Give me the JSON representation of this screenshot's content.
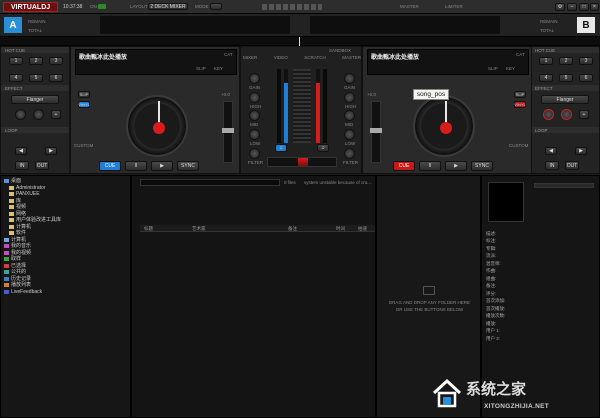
{
  "topbar": {
    "logo": "VIRTUALDJ",
    "clock": "10:37:38",
    "on_label": "ON",
    "layout_label": "LAYOUT",
    "layout_value": "2 DECK MIXER",
    "mode_label": "MODE",
    "master_label": "MASTER",
    "limiter_label": "LIMITER"
  },
  "deckA": {
    "label": "A",
    "subtitle": "REMAIN",
    "total": "TOTAL",
    "song_title": "歌曲甄冰此处播放",
    "cue": "CUE",
    "pause": "II",
    "play": "▶",
    "sync": "SYNC",
    "bpm": "+0.0",
    "hotcue": "HOT CUE",
    "effect": "EFFECT",
    "effect_value": "Flanger",
    "loop": "LOOP",
    "in": "IN",
    "out": "OUT",
    "custom": "CUSTOM",
    "cat": "CAT",
    "slip": "SLIP",
    "key": "KEY",
    "vinyl": "VINYL"
  },
  "deckB": {
    "label": "B",
    "subtitle": "REMAIN",
    "total": "TOTAL",
    "song_title": "歌曲甄冰此处播放",
    "cue": "CUE",
    "pause": "II",
    "play": "▶",
    "sync": "SYNC",
    "bpm": "+0.0",
    "hotcue": "HOT CUE",
    "effect": "EFFECT",
    "effect_value": "Flanger",
    "loop": "LOOP",
    "in": "IN",
    "out": "OUT",
    "custom": "CUSTOM",
    "cat": "CAT",
    "slip": "SLIP",
    "key": "KEY",
    "vinyl": "VINYL"
  },
  "mixer": {
    "tabs": [
      "MIXER",
      "VIDEO",
      "SCRATCH",
      "MASTER"
    ],
    "sandbox": "SANDBOX",
    "gain": "GAIN",
    "hi": "HIGH",
    "mid": "MID",
    "low": "LOW",
    "filter": "FILTER"
  },
  "tooltip": "song_pos",
  "browser": {
    "tree": [
      {
        "label": "桌面",
        "color": "#5a8fd0",
        "indent": 0
      },
      {
        "label": "Administrator",
        "color": "#d8c070",
        "indent": 1
      },
      {
        "label": "PANXUEE",
        "color": "#d8c070",
        "indent": 1
      },
      {
        "label": "库",
        "color": "#d8c070",
        "indent": 1
      },
      {
        "label": "视频",
        "color": "#d8c070",
        "indent": 1
      },
      {
        "label": "网络",
        "color": "#d8c070",
        "indent": 1
      },
      {
        "label": "用户体验改进工具库",
        "color": "#d8c070",
        "indent": 1
      },
      {
        "label": "计算机",
        "color": "#d8c070",
        "indent": 1
      },
      {
        "label": "软件",
        "color": "#d8c070",
        "indent": 1
      },
      {
        "label": "计算机",
        "color": "#7aa6d8",
        "indent": 0
      },
      {
        "label": "我的音乐",
        "color": "#c050c0",
        "indent": 0
      },
      {
        "label": "我的视频",
        "color": "#c050c0",
        "indent": 0
      },
      {
        "label": "取样",
        "color": "#40a040",
        "indent": 0
      },
      {
        "label": "已选择",
        "color": "#d04040",
        "indent": 0
      },
      {
        "label": "公共的",
        "color": "#40a0a0",
        "indent": 0
      },
      {
        "label": "历史记录",
        "color": "#4080c0",
        "indent": 0
      },
      {
        "label": "播放列表",
        "color": "#d08030",
        "indent": 0
      },
      {
        "label": "LiveFeedback",
        "color": "#4060d0",
        "indent": 0
      }
    ],
    "files_count": "0 files",
    "status_message": "system unstable because of cra...",
    "columns": [
      "标题",
      "艺术家",
      "备注",
      "时间",
      "拍速"
    ],
    "drop_line1": "DRAG AND DROP ANY FOLDER HERE",
    "drop_line2": "OR USE THE BUTTONS BELOW"
  },
  "info": {
    "rows": [
      "描述:",
      "标注:",
      "专辑:",
      "流派:",
      "混音师:",
      "作曲:",
      "组曲:",
      "备注:",
      "评分:",
      "首次添加:",
      "首次播放:",
      "播放次数:",
      "播放:",
      "用户 1:",
      "用户 2:"
    ]
  },
  "watermark": {
    "text": "系统之家",
    "url": "XITONGZHIJIA.NET"
  },
  "colors": {
    "deckA_accent": "#2a8fd9",
    "red": "#d81c1c",
    "blue_cue": "#1f7fd6"
  }
}
